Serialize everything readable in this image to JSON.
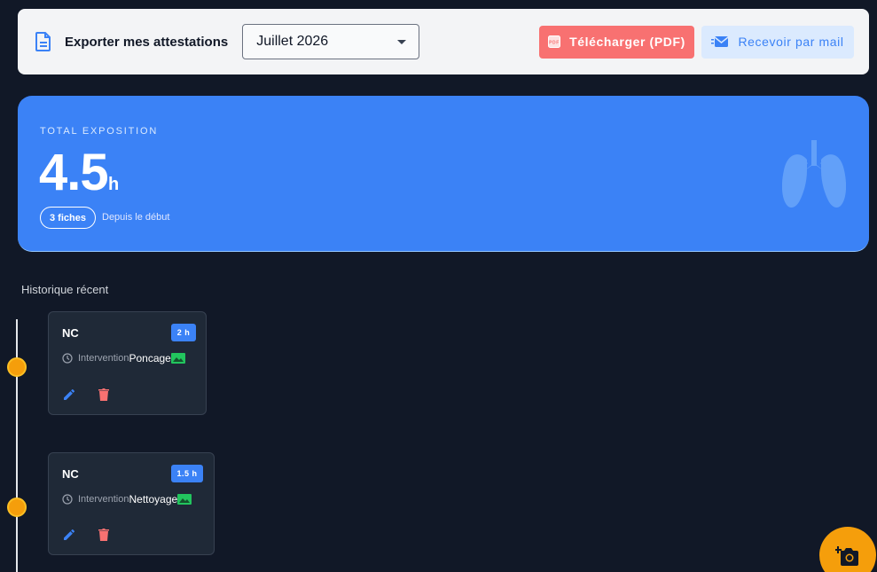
{
  "toolbar": {
    "export_label": "Exporter mes attestations",
    "month_selected": "Juillet 2026",
    "pdf_button": "Télécharger (PDF)",
    "pdf_badge": "PDF",
    "mail_button": "Recevoir par mail"
  },
  "hero": {
    "kicker": "TOTAL EXPOSITION",
    "value": "4.5",
    "unit": "h",
    "count_badge": "3 fiches",
    "since": "Depuis le début"
  },
  "history": {
    "title": "Historique récent",
    "items": [
      {
        "code": "NC",
        "duration": "2 h",
        "label": "Intervention",
        "task": "Poncage"
      },
      {
        "code": "NC",
        "duration": "1.5 h",
        "label": "Intervention",
        "task": "Nettoyage"
      }
    ]
  },
  "colors": {
    "background": "#111827",
    "accent_blue": "#3b82f6",
    "pdf_red": "#f87171",
    "timeline_orange": "#f59e0b",
    "photo_green": "#22c55e",
    "delete_red": "#ef4444"
  },
  "icons": {
    "export": "document-icon",
    "pdf": "pdf-icon",
    "mail": "mail-icon",
    "hero": "lungs-icon",
    "clock": "clock-icon",
    "photo": "image-icon",
    "edit": "pencil-icon",
    "delete": "trash-icon",
    "fab": "add-photo-icon"
  }
}
